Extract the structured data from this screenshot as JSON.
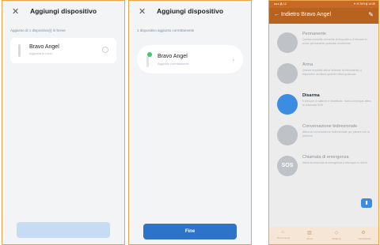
{
  "screen1": {
    "close_glyph": "✕",
    "title": "Aggiungi dispositivo",
    "subtitle": "Aggiunto di 1 dispositivo(i) in breve",
    "device_name": "Bravo Angel",
    "device_desc": "Aggiunta in corso",
    "button_label": ""
  },
  "screen2": {
    "close_glyph": "✕",
    "title": "Aggiungi dispositivo",
    "subtitle": "1 dispositivo aggiunto correttamente",
    "device_name": "Bravo Angel",
    "device_desc": "Aggiunto correttamente",
    "chevron": "›",
    "button_label": "Fine"
  },
  "screen3": {
    "status_left": "●●● ⁂ 12",
    "status_right": "✦ ✉ 75% ▮ 14:39",
    "back_glyph": "←",
    "header_title": "Indietro Bravo Angel",
    "edit_glyph": "✎",
    "features": [
      {
        "title": "Permanente",
        "desc": "Questa modalità consente al dispositivo di rilevare in modo permanente qualsiasi movimento",
        "icon_text": "",
        "active": false
      },
      {
        "title": "Arma",
        "desc": "Questa modalità attiva l'allarme di rilevamento; il dispositivo avviserà quando rileva qualcosa",
        "icon_text": "",
        "active": false
      },
      {
        "title": "Disarma",
        "desc": "Il sensore di allarme è disattivato. Sarà comunque attivo la chiamata SOS",
        "icon_text": "",
        "active": true
      },
      {
        "title": "Conversazione bidirezionale",
        "desc": "Attiva la conversazione bidirezionale per parlare con la persona",
        "icon_text": "",
        "active": false
      },
      {
        "title": "Chiamata di emergenza",
        "desc": "Attiva la chiamata di emergenza a chiunque lo riceve",
        "icon_text": "SOS",
        "active": false
      }
    ],
    "fab_glyph": "▮",
    "tabs": [
      {
        "glyph": "⌂",
        "label": "Permanente"
      },
      {
        "glyph": "▥",
        "label": "Arma"
      },
      {
        "glyph": "◇",
        "label": "Disarma"
      },
      {
        "glyph": "⚙",
        "label": "Impostazioni"
      }
    ]
  }
}
